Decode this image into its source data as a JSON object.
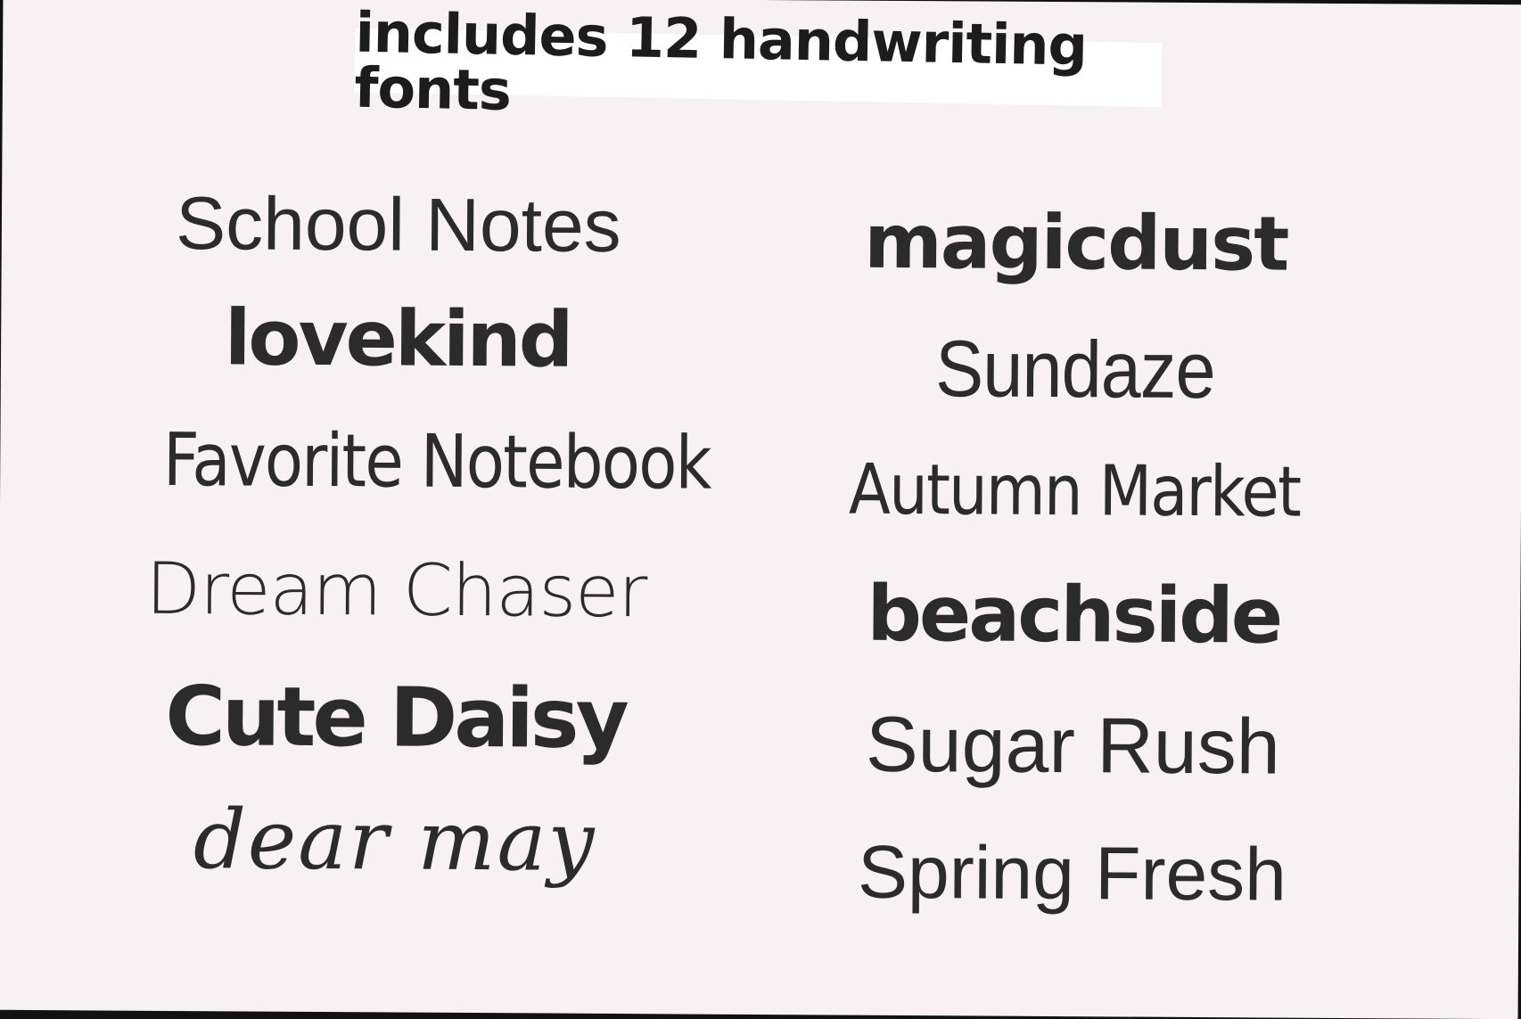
{
  "banner": {
    "text": "includes 12 handwriting fonts"
  },
  "fonts": {
    "left": [
      "School Notes",
      "lovekind",
      "Favorite Notebook",
      "Dream Chaser",
      "Cute Daisy",
      "dear may"
    ],
    "right": [
      "magicdust",
      "Sundaze",
      "Autumn Market",
      "beachside",
      "Sugar Rush",
      "Spring Fresh"
    ]
  },
  "colors": {
    "background": "#f7f1f3",
    "banner": "#ffffff",
    "text": "#2b2b2b",
    "frame": "#111111"
  }
}
